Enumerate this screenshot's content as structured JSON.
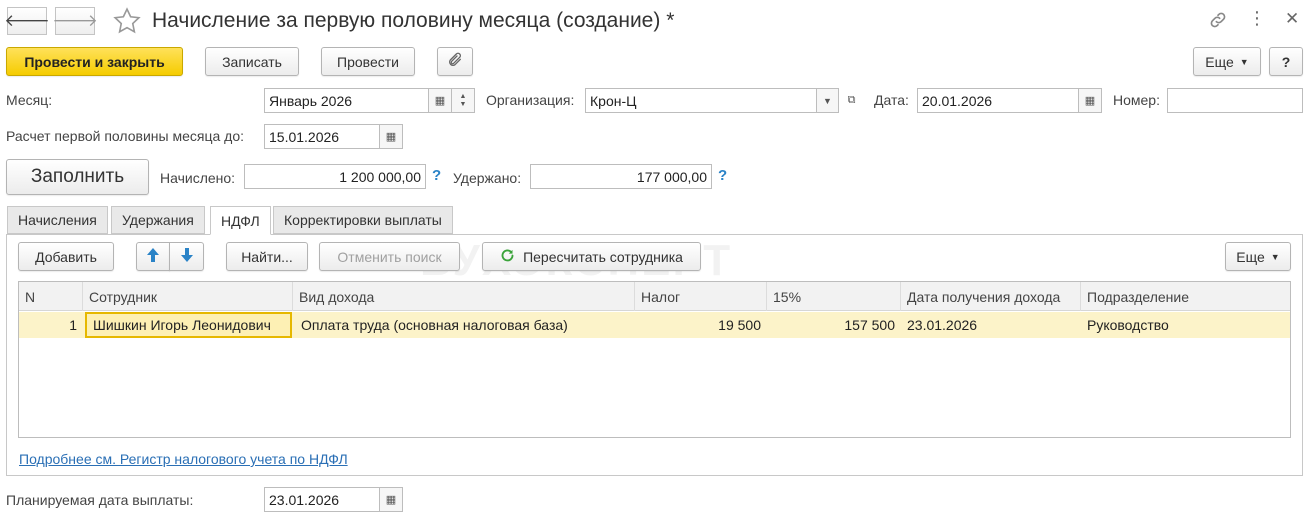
{
  "window": {
    "title": "Начисление за первую половину месяца (создание) *",
    "more_menu_icon": "⋮",
    "close_icon": "✕"
  },
  "toolbar": {
    "post_close_label": "Провести и закрыть",
    "save_label": "Записать",
    "post_label": "Провести",
    "more_label": "Еще",
    "help_label": "?"
  },
  "form": {
    "month_label": "Месяц:",
    "month_value": "Январь 2026",
    "org_label": "Организация:",
    "org_value": "Крон-Ц",
    "date_label": "Дата:",
    "date_value": "20.01.2026",
    "number_label": "Номер:",
    "number_value": "",
    "calc_until_label": "Расчет первой половины месяца до:",
    "calc_until_value": "15.01.2026",
    "fill_label": "Заполнить",
    "accrued_label": "Начислено:",
    "accrued_value": "1 200 000,00",
    "withheld_label": "Удержано:",
    "withheld_value": "177 000,00",
    "help_mark": "?",
    "planned_date_label": "Планируемая дата выплаты:",
    "planned_date_value": "23.01.2026"
  },
  "tabs": [
    {
      "label": "Начисления"
    },
    {
      "label": "Удержания"
    },
    {
      "label": "НДФЛ"
    },
    {
      "label": "Корректировки выплаты"
    }
  ],
  "panel": {
    "add_label": "Добавить",
    "find_label": "Найти...",
    "cancel_search_label": "Отменить поиск",
    "recalc_label": "Пересчитать сотрудника",
    "more_label": "Еще",
    "watermark": "БУХЭКСПЕРТ",
    "link_text": "Подробнее см. Регистр налогового учета по НДФЛ"
  },
  "table": {
    "headers": [
      "N",
      "Сотрудник",
      "Вид дохода",
      "Налог",
      "15%",
      "Дата получения дохода",
      "Подразделение"
    ],
    "rows": [
      [
        "1",
        "Шишкин Игорь Леонидович",
        "Оплата труда (основная налоговая база)",
        "19 500",
        "157 500",
        "23.01.2026",
        "Руководство"
      ]
    ]
  },
  "colors": {
    "primary_button": "#f5cc00",
    "selected_row": "#fcf3c9",
    "link": "#2a6fb5",
    "help_mark": "#2a83c7"
  }
}
